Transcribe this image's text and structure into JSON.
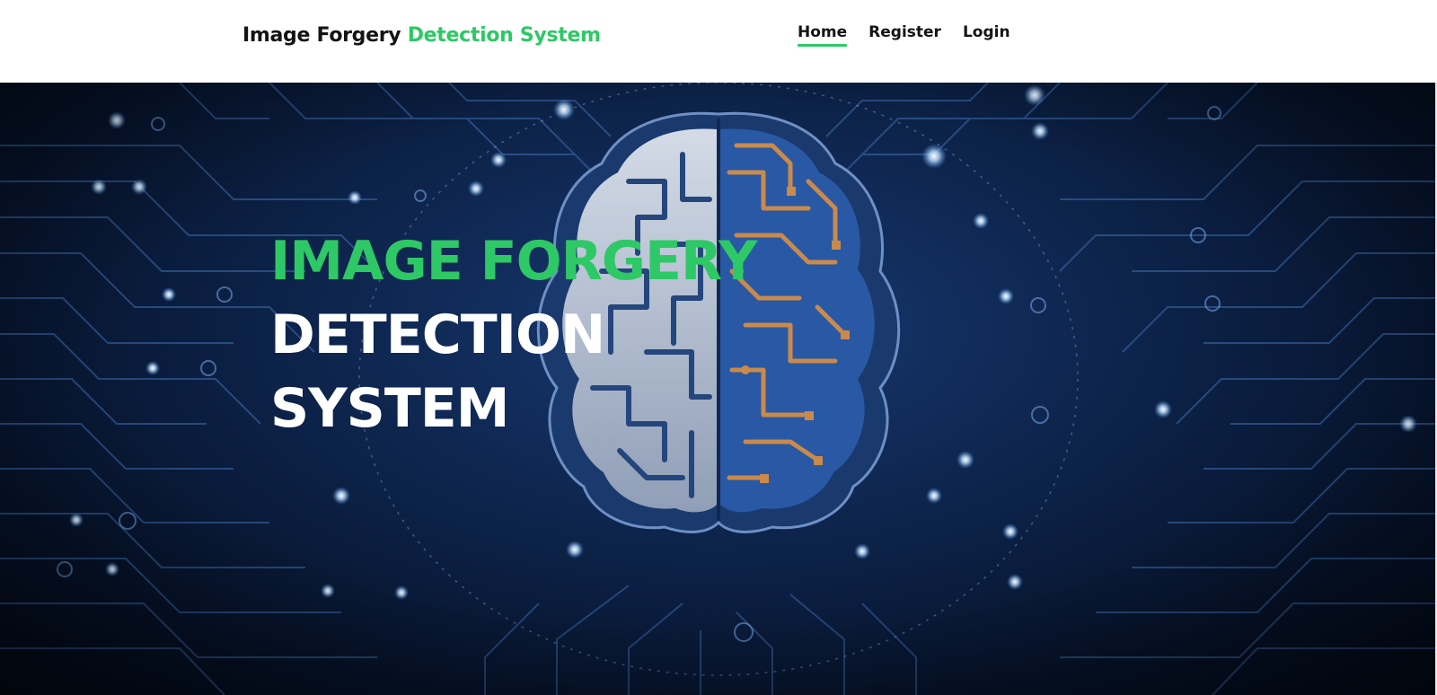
{
  "header": {
    "brand_part1": "Image Forgery",
    "brand_part2": "Detection System"
  },
  "nav": {
    "items": [
      {
        "label": "Home",
        "active": true
      },
      {
        "label": "Register",
        "active": false
      },
      {
        "label": "Login",
        "active": false
      }
    ]
  },
  "hero": {
    "title_line1": "IMAGE FORGERY",
    "title_line2": "DETECTION",
    "title_line3": "SYSTEM",
    "background_icon": "circuit-brain-illustration"
  },
  "colors": {
    "accent": "#2ec866",
    "text_dark": "#141414",
    "hero_bg": "#0d234a",
    "circuit_glow": "#8fc1ff",
    "brain_copper": "#c98a4c",
    "brain_silver": "#c6cfdd"
  }
}
